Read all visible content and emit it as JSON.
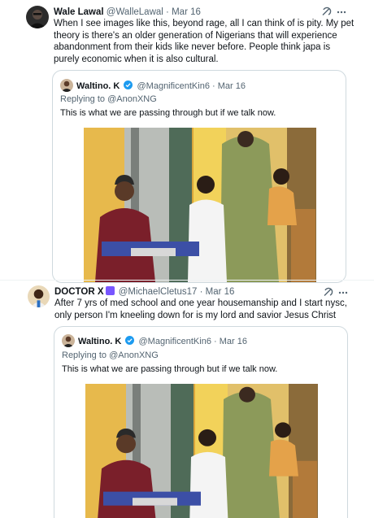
{
  "tweet1": {
    "name": "Wale Lawal",
    "handle": "@WalleLawal",
    "separator": "·",
    "date": "Mar 16",
    "text": "When I see images like this, beyond rage, all I can think of is pity. My pet theory is there's an older generation of Nigerians that will experience abandonment from their kids like never before. People think japa is purely economic when it is also cultural.",
    "quote": {
      "name": "Waltino. K",
      "handle": "@MagnificentKin6",
      "separator": "·",
      "date": "Mar 16",
      "replying": "Replying to @AnonXNG",
      "text": "This is what we are passing through but if we talk now."
    }
  },
  "tweet2": {
    "name": "DOCTOR X",
    "handle": "@MichaelCletus17",
    "separator": "·",
    "date": "Mar 16",
    "text": "After 7 yrs of med school and one year housemanship and I start nysc, only person I'm kneeling down for is my lord and savior Jesus Christ",
    "quote": {
      "name": "Waltino. K",
      "handle": "@MagnificentKin6",
      "separator": "·",
      "date": "Mar 16",
      "replying": "Replying to @AnonXNG",
      "text": "This is what we are passing through but if we talk now."
    }
  },
  "icons": [
    "grok-icon",
    "more-icon",
    "verified-icon",
    "badge-emoji-icon"
  ],
  "colors": {
    "verified": "#1d9bf0",
    "muted": "#536471",
    "border": "#cfd9de"
  }
}
